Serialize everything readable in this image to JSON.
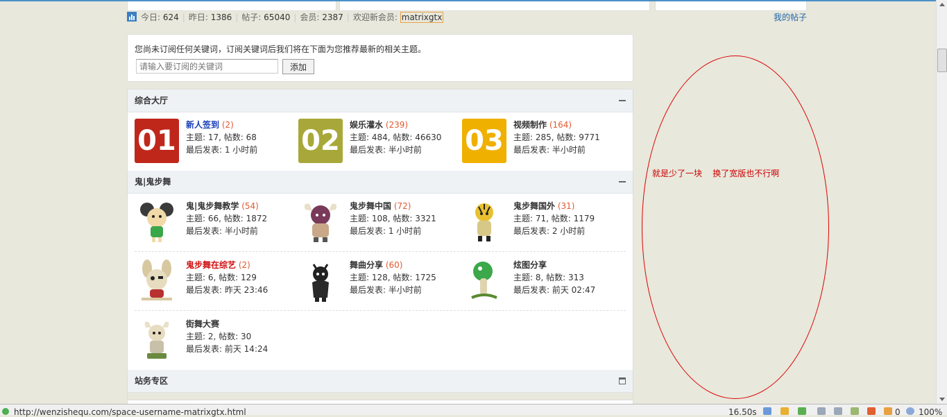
{
  "stats": {
    "today_label": "今日:",
    "today": "624",
    "yesterday_label": "昨日:",
    "yesterday": "1386",
    "posts_label": "帖子:",
    "posts": "65040",
    "members_label": "会员:",
    "members": "2387",
    "welcome_label": "欢迎新会员:",
    "new_member": "matrixgtx"
  },
  "my_threads": "我的帖子",
  "subscribe": {
    "message": "您尚未订阅任何关键词，订阅关键词后我们将在下面为您推荐最新的相关主题。",
    "placeholder": "请输入要订阅的关键词",
    "add_label": "添加"
  },
  "sections": [
    {
      "title": "综合大厅",
      "forums": [
        {
          "badge": "01",
          "badge_color": "#c0271b",
          "name": "新人签到",
          "today": "(2)",
          "stats": "主题: 17, 帖数: 68",
          "last": "最后发表: 1 小时前"
        },
        {
          "badge": "02",
          "badge_color": "#a8a83a",
          "name": "娱乐灌水",
          "today": "(239)",
          "stats": "主题: 484, 帖数: 46630",
          "last": "最后发表: 半小时前"
        },
        {
          "badge": "03",
          "badge_color": "#f0b000",
          "name": "视频制作",
          "today": "(164)",
          "stats": "主题: 285, 帖数: 9771",
          "last": "最后发表: 半小时前"
        }
      ]
    },
    {
      "title": "鬼|鬼步舞",
      "forums": [
        {
          "icon": "cartoon-mouse-icon",
          "name": "鬼|鬼步舞教学",
          "today": "(54)",
          "stats": "主题: 66, 帖数: 1872",
          "last": "最后发表: 半小时前"
        },
        {
          "icon": "cartoon-horned-monster-icon",
          "name": "鬼步舞中国",
          "today": "(72)",
          "stats": "主题: 108, 帖数: 3321",
          "last": "最后发表: 1 小时前"
        },
        {
          "icon": "cartoon-tiger-icon",
          "name": "鬼步舞国外",
          "today": "(31)",
          "stats": "主题: 71, 帖数: 1179",
          "last": "最后发表: 2 小时前"
        },
        {
          "icon": "cartoon-bunny-icon",
          "name": "鬼步舞在综艺",
          "today": "(2)",
          "stats": "主题: 6, 帖数: 129",
          "last": "最后发表: 昨天 23:46"
        },
        {
          "icon": "cartoon-black-creature-icon",
          "name": "舞曲分享",
          "today": "(60)",
          "stats": "主题: 128, 帖数: 1725",
          "last": "最后发表: 半小时前"
        },
        {
          "icon": "cartoon-mushroom-icon",
          "name": "炫图分享",
          "today": "",
          "stats": "主题: 8, 帖数: 313",
          "last": "最后发表: 前天 02:47"
        },
        {
          "icon": "cartoon-viking-icon",
          "name": "街舞大赛",
          "today": "",
          "stats": "主题: 2, 帖数: 30",
          "last": "最后发表: 前天 14:24"
        }
      ]
    },
    {
      "title": "站务专区",
      "forums": []
    }
  ],
  "annotation": "就是少了一块    换了宽版也不行啊",
  "statusbar": {
    "url": "http://wenzishequ.com/space-username-matrixgtx.html",
    "time": "16.50s",
    "count": "0",
    "zoom": "100%"
  },
  "colors": {
    "annotation": "#d00000",
    "link_blue": "#1a3fb8",
    "today_count": "#e05a30",
    "highlight_red": "#d01010"
  }
}
